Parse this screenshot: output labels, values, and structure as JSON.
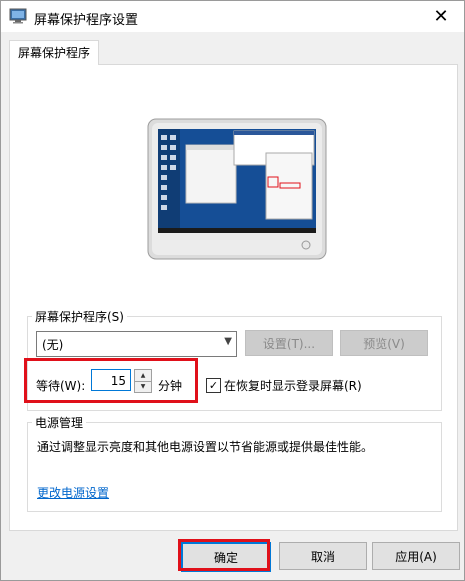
{
  "window": {
    "title": "屏幕保护程序设置",
    "close_label": "✕"
  },
  "tabs": [
    {
      "label": "屏幕保护程序"
    }
  ],
  "screensaver": {
    "group_label": "屏幕保护程序(S)",
    "selected": "(无)",
    "settings_button": "设置(T)...",
    "preview_button": "预览(V)",
    "wait_label": "等待(W):",
    "wait_value": "15",
    "minutes_label": "分钟",
    "resume_checkbox_label": "在恢复时显示登录屏幕(R)",
    "resume_checked": true
  },
  "power": {
    "group_label": "电源管理",
    "description": "通过调整显示亮度和其他电源设置以节省能源或提供最佳性能。",
    "link": "更改电源设置"
  },
  "buttons": {
    "ok": "确定",
    "cancel": "取消",
    "apply": "应用(A)"
  },
  "colors": {
    "accent": "#0078d7",
    "highlight": "#e0101a",
    "link": "#0066cc"
  }
}
